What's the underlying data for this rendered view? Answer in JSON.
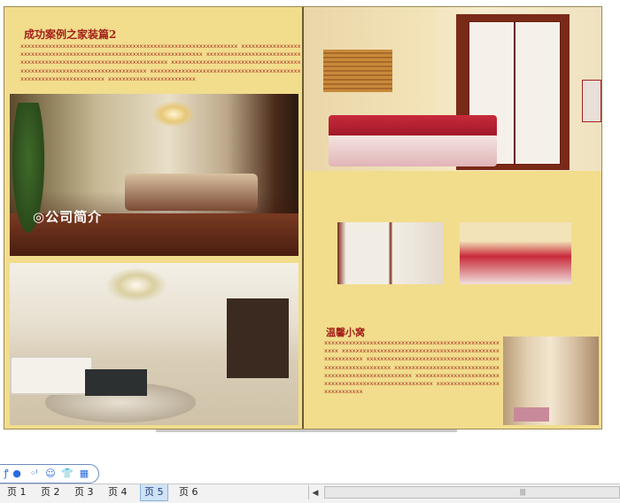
{
  "spread": {
    "left_page": {
      "title": "成功案例之家装篇2",
      "body": "xxxxxxxxxxxxxxxxxxxxxxxxxxxxxxxxxxxxxxxxxxxxxxxxxxxxxxxxxxxxxx xxxxxxxxxxxxxxxxxxxxxxxxxxxxxxxxxxxxxxxxxxxxxxxxxxxxxxxxxxxxxxxxxxxxx xxxxxxxxxxxxxxxxxxxxxxxxxxxxxxxxxxxxxxxxxxxxxxxxxxxxxxxxxxxxxxxxxxxxx xxxxxxxxxxxxxxxxxxxxxxxxxxxxxxxxxxxxxxxxxxxxxxxxxxxxxxxxxxxxxxxxxxxxxxxxx xxxxxxxxxxxxxxxxxxxxxxxxxxxxxxxxxxxxxxxxxxxxxxxxxxxxxxxxxxxxxxxxxxx xxxxxxxxxxxxxxxxxxxxxxxxx",
      "overlay_text": "◎公司简介"
    },
    "right_page": {
      "subtitle": "温馨小窝",
      "body": "xxxxxxxxxxxxxxxxxxxxxxxxxxxxxxxxxxxxxxxxxxxxxxxxxxxxxx xxxxxxxxxxxxxxxxxxxxxxxxxxxxxxxxxxxxxxxxxxxxxxxxxxxxxxxx xxxxxxxxxxxxxxxxxxxxxxxxxxxxxxxxxxxxxxxxxxxxxxxxxxxxxxxxx xxxxxxxxxxxxxxxxxxxxxxxxxxxxxxxxxxxxxxxxxxxxxxxxxxxxxxx xxxxxxxxxxxxxxxxxxxxxxxxxxxxxxxxxxxxxxxxxxxxxxxxxxxxxxx xxxxxxxxxxxxxxxxxxxxxxxxxxxxx"
    }
  },
  "toolbar": {
    "icons": [
      "link-icon",
      "circle-icon",
      "dot-icon",
      "smiley-icon",
      "shirt-icon",
      "grid-icon"
    ],
    "glyphs": [
      "ꝭ",
      "●",
      "◦ˡ",
      "☺",
      "👕",
      "▦"
    ]
  },
  "tabs": [
    {
      "label": "页 1",
      "active": false
    },
    {
      "label": "页 2",
      "active": false
    },
    {
      "label": "页 3",
      "active": false
    },
    {
      "label": "页 4",
      "active": false
    },
    {
      "label": "页 5",
      "active": true
    },
    {
      "label": "页 6",
      "active": false
    }
  ],
  "scrollbar": {
    "left_arrow": "◀",
    "grip": "|||"
  },
  "colors": {
    "page_bg": "#f1dd8c",
    "title_red": "#a4201a",
    "active_tab": "#cfe3f7"
  }
}
